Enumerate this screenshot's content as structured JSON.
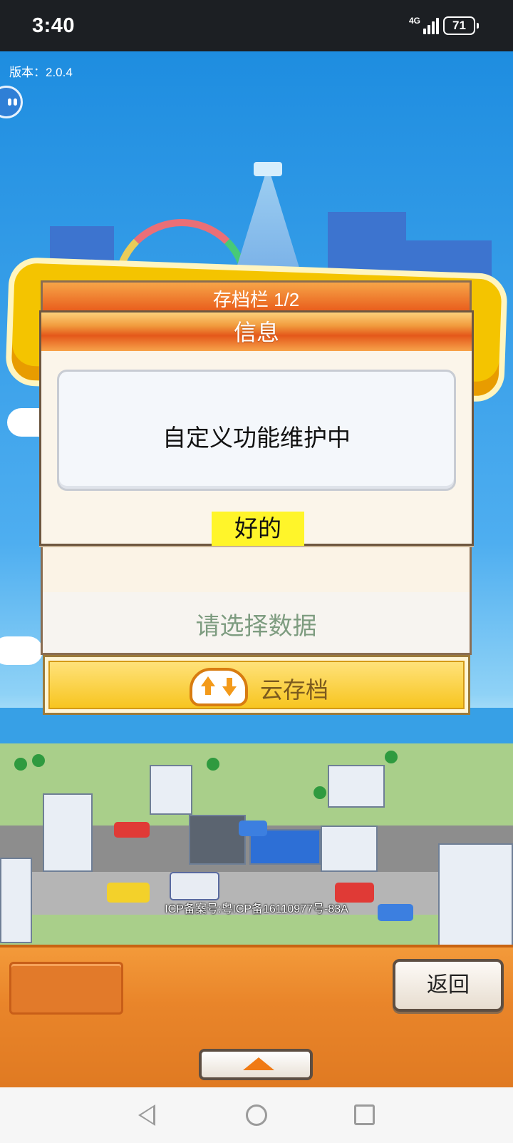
{
  "status_bar": {
    "time": "3:40",
    "network": "4G",
    "battery": "71",
    "icons": [
      "signal-icon",
      "battery-icon"
    ]
  },
  "game": {
    "version": "版本：2.0.4",
    "icp": "ICP备案号:粤ICP备16110977号-83A"
  },
  "save_panel": {
    "title": "存档栏 1/2",
    "select_prompt": "请选择数据",
    "cloud_save_label": "云存档"
  },
  "dialog": {
    "title": "信息",
    "message": "自定义功能维护中",
    "ok_label": "好的"
  },
  "bottom_panel": {
    "back_label": "返回"
  },
  "nav_bar": {
    "icons": [
      "back-triangle-icon",
      "home-circle-icon",
      "recents-square-icon"
    ]
  },
  "colors": {
    "dialog_header": "#e95d1c",
    "ok_button": "#fff52a",
    "bottom_panel": "#e9852a",
    "sky": "#4eaef0"
  }
}
